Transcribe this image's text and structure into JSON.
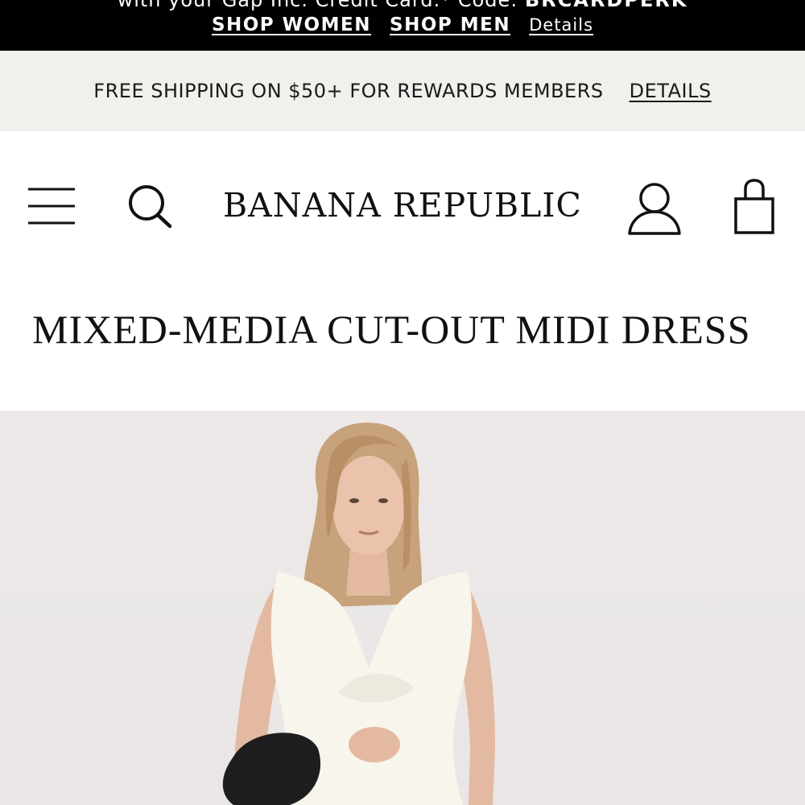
{
  "promo": {
    "line1_text": "with your Gap Inc. Credit Card.*  Code: ",
    "code": "BRCARDPERK",
    "shop_women": "SHOP WOMEN",
    "shop_men": "SHOP MEN",
    "details": "Details"
  },
  "shipping": {
    "text": "FREE SHIPPING ON $50+ FOR REWARDS MEMBERS",
    "details": "DETAILS"
  },
  "header": {
    "logo": "BANANA REPUBLIC",
    "icons": [
      "menu-icon",
      "search-icon",
      "account-icon",
      "shopping-bag-icon"
    ]
  },
  "product": {
    "title": "MIXED-MEDIA CUT-OUT MIDI DRESS"
  },
  "colors": {
    "promo_bg": "#000000",
    "shipping_bg": "#f1f0ed",
    "image_bg": "#ece9e8"
  }
}
